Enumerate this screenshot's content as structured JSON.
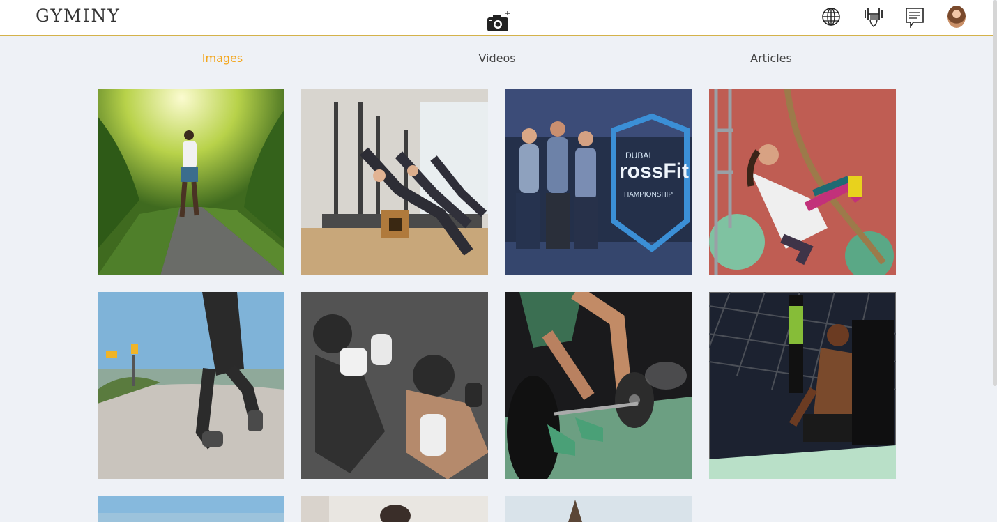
{
  "app": {
    "logo": "GYMINY"
  },
  "header": {
    "icons": [
      "camera-add-icon",
      "globe-icon",
      "fitness-icon",
      "chat-icon",
      "avatar"
    ]
  },
  "tabs": [
    {
      "label": "Images",
      "active": true
    },
    {
      "label": "Videos",
      "active": false
    },
    {
      "label": "Articles",
      "active": false
    }
  ],
  "gallery": {
    "images": [
      {
        "subject": "woman running on forest road"
      },
      {
        "subject": "pilates reformer class"
      },
      {
        "subject": "Dubai CrossFit Championship athletes"
      },
      {
        "subject": "woman climbing rope"
      },
      {
        "subject": "runner on coastal road"
      },
      {
        "subject": "kickboxing sparring"
      },
      {
        "subject": "barbell deadlift"
      },
      {
        "subject": "fighter in cage arena"
      },
      {
        "subject": "sky and sea"
      },
      {
        "subject": "woman indoors"
      },
      {
        "subject": "surfboard on beach"
      }
    ]
  },
  "colors": {
    "accent": "#f3a61c",
    "header_border": "#d4b24a",
    "page_bg": "#eef1f6"
  }
}
